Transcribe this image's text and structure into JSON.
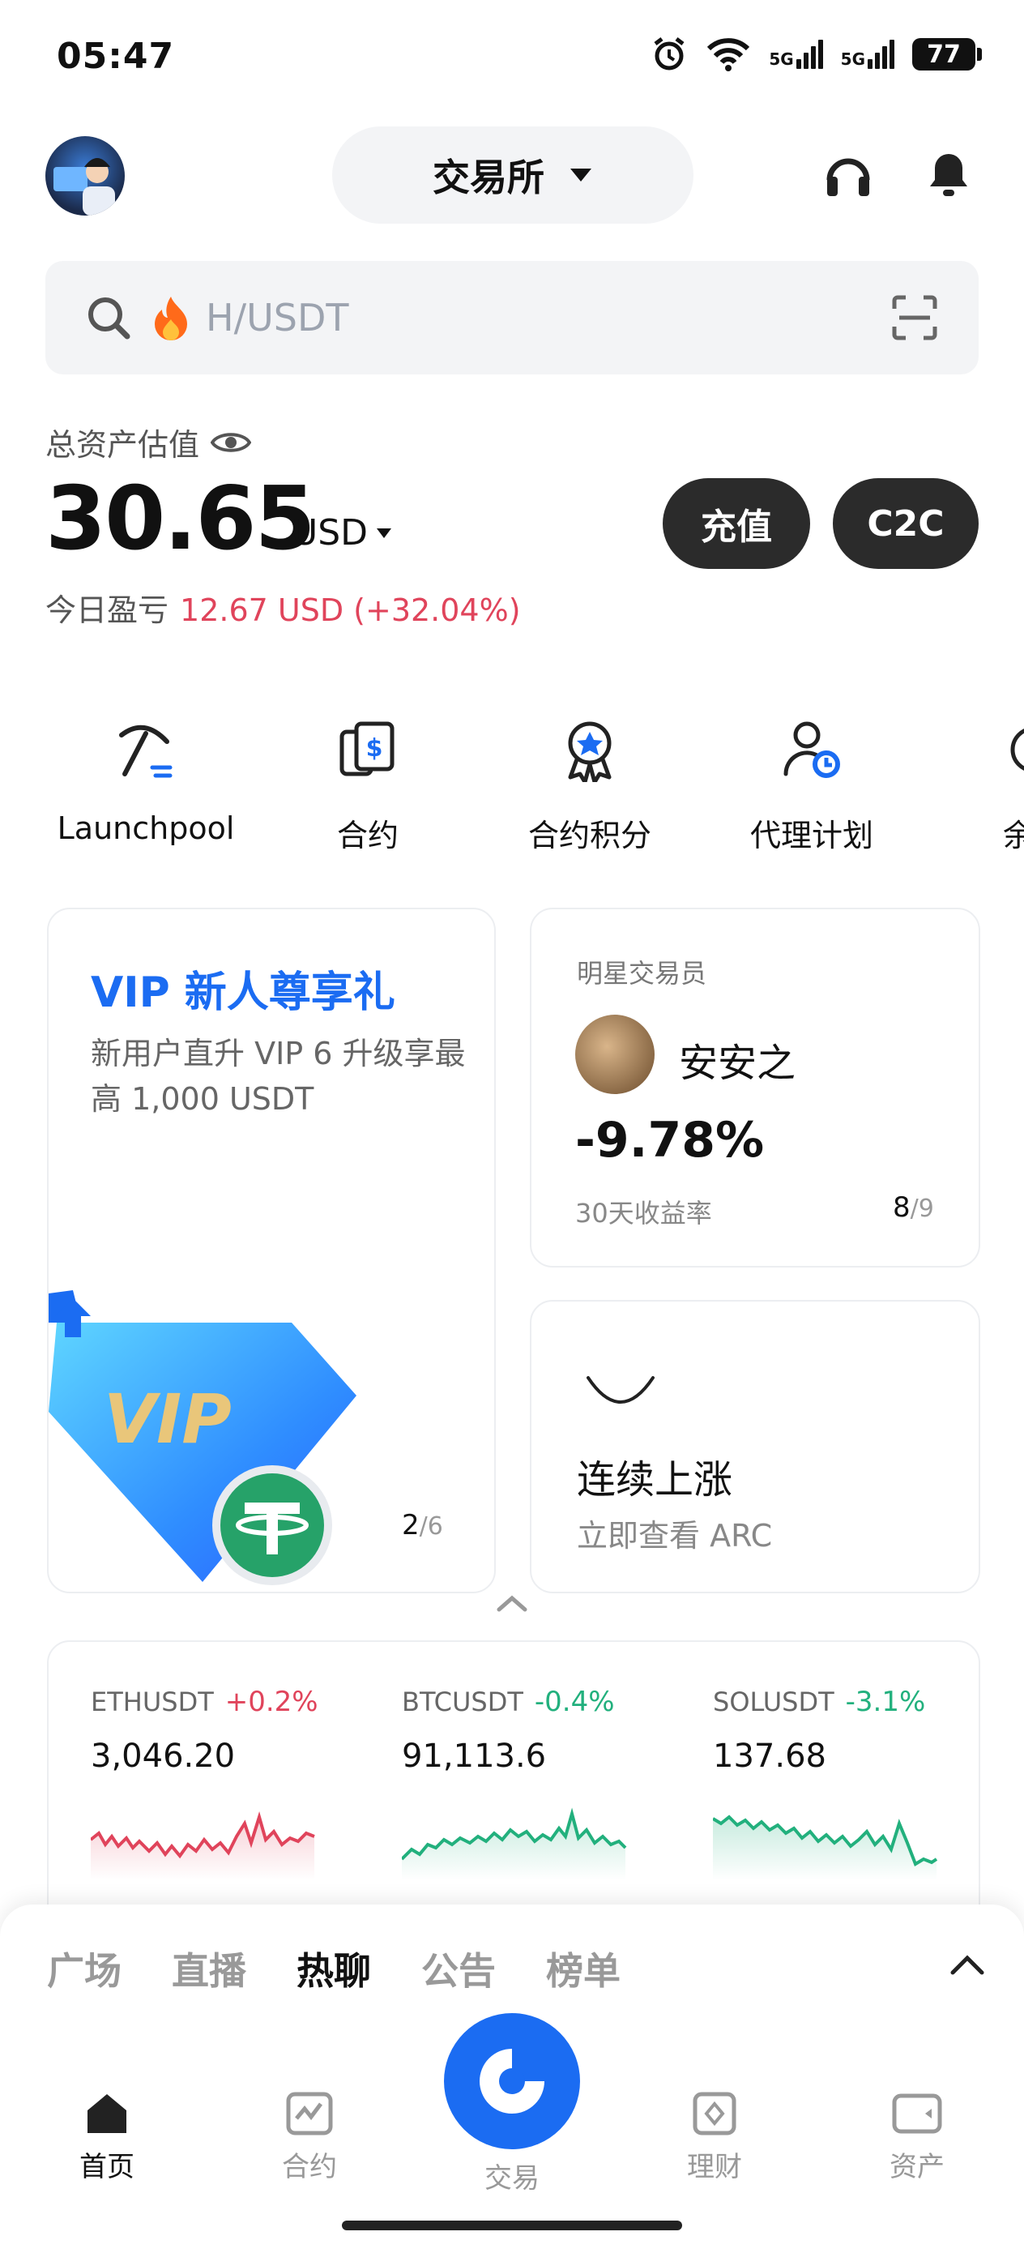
{
  "status_bar": {
    "time": "05:47",
    "net1": "5G",
    "net2": "5G",
    "battery": "77"
  },
  "header": {
    "exchange_label": "交易所"
  },
  "search": {
    "placeholder": "H/USDT"
  },
  "assets": {
    "label": "总资产估值",
    "value": "30.65",
    "unit": "USD",
    "pnl_label": "今日盈亏",
    "pnl_value": "12.67 USD (+32.04%)",
    "deposit_label": "充值",
    "c2c_label": "C2C"
  },
  "quick_menu": [
    {
      "label": "Launchpool",
      "icon": "pickaxe-icon"
    },
    {
      "label": "合约",
      "icon": "dollar-document-icon"
    },
    {
      "label": "合约积分",
      "icon": "medal-icon"
    },
    {
      "label": "代理计划",
      "icon": "agent-icon"
    },
    {
      "label": "余币",
      "icon": "savings-icon"
    }
  ],
  "vip_card": {
    "title": "VIP 新人尊享礼",
    "subtitle": "新用户直升 VIP 6 升级享最高 1,000 USDT",
    "badge_text": "VIP",
    "page_current": "2",
    "page_total": "/6"
  },
  "trader_card": {
    "heading": "明星交易员",
    "name": "安安之",
    "return": "-9.78%",
    "return_label": "30天收益率",
    "page_current": "8",
    "page_total": "/9"
  },
  "trend_card": {
    "title": "连续上涨",
    "subtitle": "立即查看 ARC"
  },
  "tickers": [
    {
      "symbol": "ETHUSDT",
      "change": "+0.2%",
      "price": "3,046.20",
      "color": "#e0445b"
    },
    {
      "symbol": "BTCUSDT",
      "change": "-0.4%",
      "price": "91,113.6",
      "color": "#22b07d"
    },
    {
      "symbol": "SOLUSDT",
      "change": "-3.1%",
      "price": "137.68",
      "color": "#22b07d"
    }
  ],
  "feed_tabs": [
    "广场",
    "直播",
    "热聊",
    "公告",
    "榜单"
  ],
  "active_feed_tab": "热聊",
  "bottom_nav": [
    {
      "label": "首页",
      "icon": "home-icon"
    },
    {
      "label": "合约",
      "icon": "futures-icon"
    },
    {
      "label": "交易",
      "icon": "trade-icon"
    },
    {
      "label": "理财",
      "icon": "finance-icon"
    },
    {
      "label": "资产",
      "icon": "wallet-icon"
    }
  ],
  "colors": {
    "accent": "#1b6cf2",
    "up": "#22b07d",
    "down": "#e0445b",
    "dark_button": "#2b2b2b"
  }
}
